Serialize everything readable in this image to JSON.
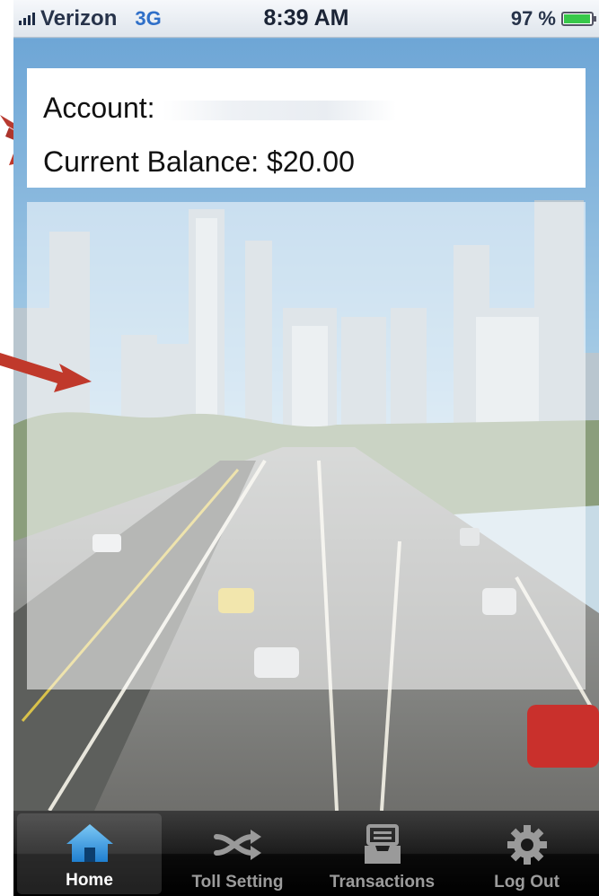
{
  "status_bar": {
    "carrier": "Verizon",
    "network": "3G",
    "time": "8:39 AM",
    "battery_percent": "97 %",
    "battery_level": 0.97
  },
  "account": {
    "account_label": "Account:",
    "balance_label": "Current Balance: $20.00"
  },
  "tabs": [
    {
      "label": "Home",
      "icon": "home-icon",
      "active": true
    },
    {
      "label": "Toll Setting",
      "icon": "shuffle-icon",
      "active": false
    },
    {
      "label": "Transactions",
      "icon": "inbox-tray-icon",
      "active": false
    },
    {
      "label": "Log Out",
      "icon": "gear-icon",
      "active": false
    }
  ],
  "colors": {
    "accent": "#2f6fc8",
    "annotation_arrow": "#c0392b",
    "battery": "#38c84a",
    "tab_bar": "#1c1c1c"
  }
}
